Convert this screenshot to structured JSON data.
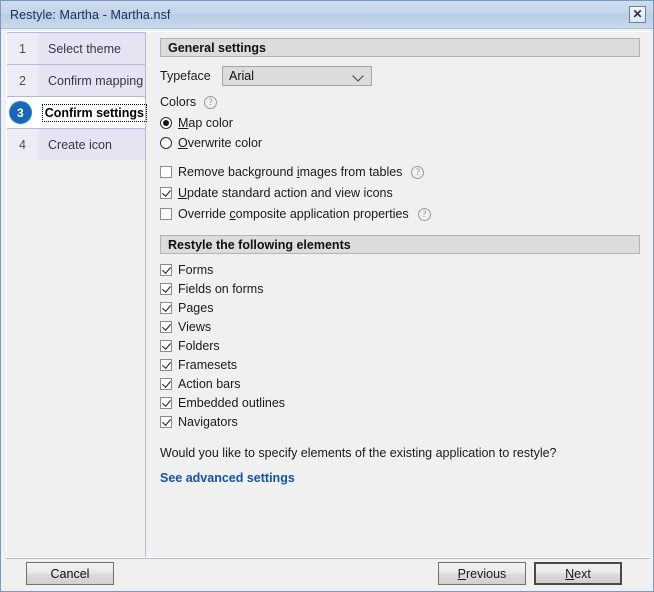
{
  "window": {
    "title": "Restyle: Martha - Martha.nsf",
    "close_label": "✕",
    "accent_color": "#1667b8",
    "link_color": "#1155aa"
  },
  "sidebar": {
    "steps": [
      {
        "number": "1",
        "label": "Select theme",
        "active": false
      },
      {
        "number": "2",
        "label": "Confirm mapping",
        "active": false
      },
      {
        "number": "3",
        "label": "Confirm settings",
        "active": true
      },
      {
        "number": "4",
        "label": "Create icon",
        "active": false
      }
    ]
  },
  "general": {
    "header": "General settings",
    "typeface_label": "Typeface",
    "typeface_value": "Arial",
    "typeface_options": [
      "Arial"
    ],
    "colors_label": "Colors",
    "colors_help": "?",
    "radios": [
      {
        "label_pre": "",
        "mnemonic": "M",
        "label_post": "ap color",
        "selected": true
      },
      {
        "label_pre": "",
        "mnemonic": "O",
        "label_post": "verwrite color",
        "selected": false
      }
    ],
    "options": [
      {
        "label_pre": "Remove background ",
        "mnemonic": "i",
        "label_post": "mages from tables",
        "checked": false,
        "help": "?"
      },
      {
        "label_pre": "",
        "mnemonic": "U",
        "label_post": "pdate standard action and view icons",
        "checked": true,
        "help": ""
      },
      {
        "label_pre": "Override ",
        "mnemonic": "c",
        "label_post": "omposite application properties",
        "checked": false,
        "help": "?"
      }
    ]
  },
  "elements": {
    "header": "Restyle the following elements",
    "items": [
      {
        "label": "Forms",
        "checked": true
      },
      {
        "label": "Fields on forms",
        "checked": true
      },
      {
        "label": "Pages",
        "checked": true
      },
      {
        "label": "Views",
        "checked": true
      },
      {
        "label": "Folders",
        "checked": true
      },
      {
        "label": "Framesets",
        "checked": true
      },
      {
        "label": "Action bars",
        "checked": true
      },
      {
        "label": "Embedded outlines",
        "checked": true
      },
      {
        "label": "Navigators",
        "checked": true
      }
    ]
  },
  "advanced": {
    "question": "Would you like to specify elements of the existing application to restyle?",
    "link": "See advanced settings"
  },
  "footer": {
    "cancel": "Cancel",
    "previous_pre": "",
    "previous_mnemonic": "P",
    "previous_post": "revious",
    "next_pre": "",
    "next_mnemonic": "N",
    "next_post": "ext"
  }
}
